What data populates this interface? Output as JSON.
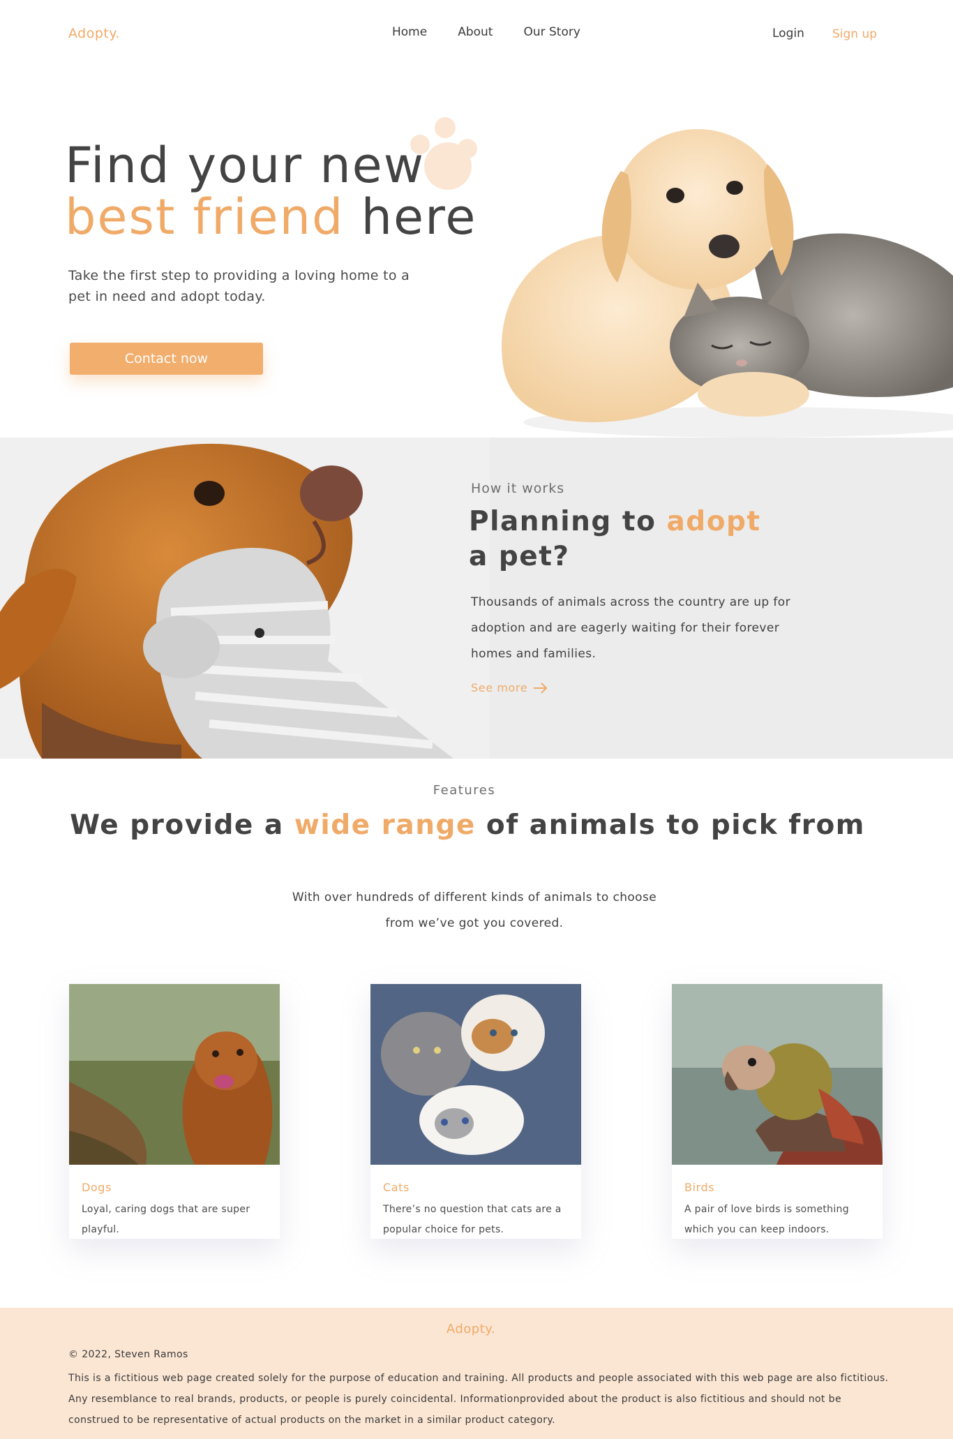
{
  "nav": {
    "logo": "Adopty.",
    "links": [
      "Home",
      "About",
      "Our Story"
    ],
    "login": "Login",
    "signup": "Sign up"
  },
  "hero": {
    "title_line1": "Find your new",
    "title_accent": "best friend",
    "title_rest": " here",
    "subtitle": "Take the first step to providing a loving home to a pet in need and adopt today.",
    "cta": "Contact now",
    "image_alt": "puppy-and-kitten-photo"
  },
  "how": {
    "label": "How it works",
    "title_before": "Planning to ",
    "title_accent": "adopt",
    "title_after": " a pet?",
    "text": "Thousands of animals across the country are up for adoption and are eagerly waiting for their forever homes and families.",
    "see_more": "See more",
    "image_alt": "dog-with-toy-photo"
  },
  "features": {
    "label": "Features",
    "title_before": "We provide a ",
    "title_accent": "wide range",
    "title_after": " of animals to pick from",
    "subtitle_line1": "With over hundreds of different kinds of animals to choose",
    "subtitle_line2": "from we’ve got you covered.",
    "cards": [
      {
        "name": "Dogs",
        "desc": "Loyal, caring dogs that are super playful."
      },
      {
        "name": "Cats",
        "desc": "There’s no question that cats are a popular choice for pets."
      },
      {
        "name": "Birds",
        "desc": "A pair of love birds is something which you can keep indoors."
      }
    ]
  },
  "footer": {
    "logo": "Adopty.",
    "copyright": "© 2022, Steven Ramos",
    "disclaimer": "This is a fictitious web page created solely for the purpose of education and training. All products and people associated with this web page are also  fictitious. Any resemblance to real brands, products, or people is purely coincidental. Informationprovided about the product is also fictitious and should not be construed to be representative of actual products on the market in a similar product category."
  },
  "colors": {
    "accent": "#f0aa68",
    "text": "#434343",
    "section_bg": "#ececec",
    "footer_bg": "#fbe6d3"
  }
}
